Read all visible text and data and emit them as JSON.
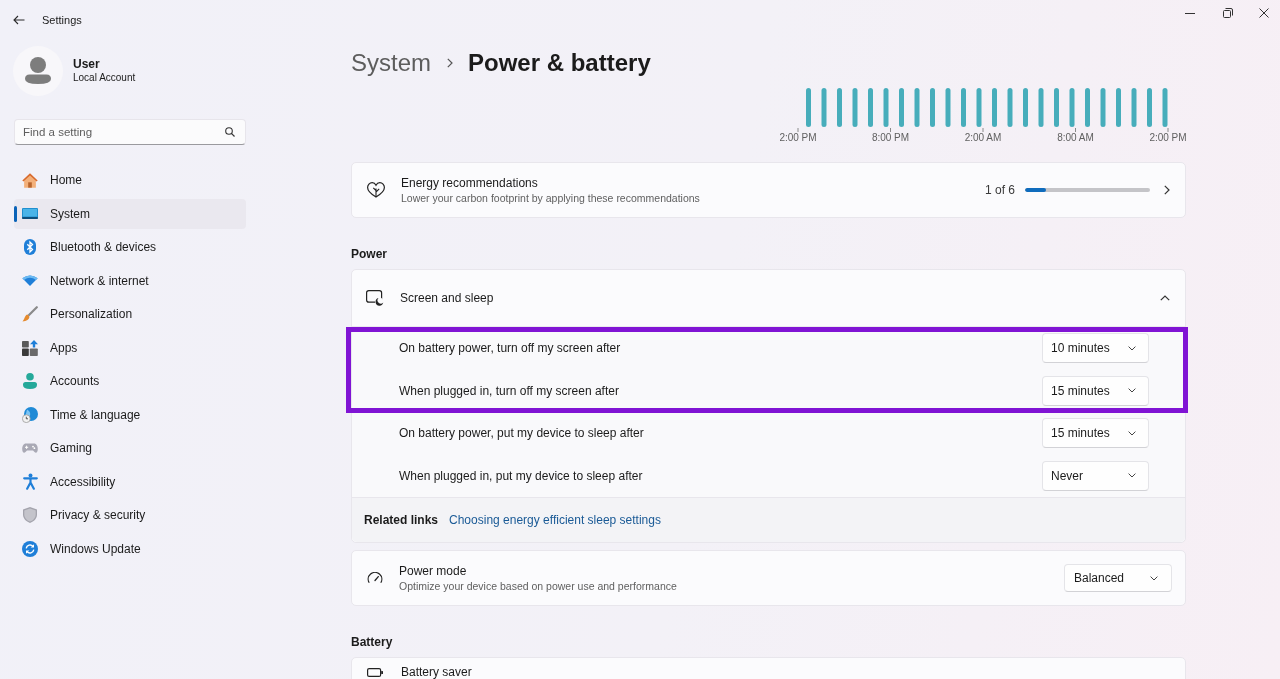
{
  "window": {
    "title": "Settings"
  },
  "account": {
    "name": "User",
    "type": "Local Account"
  },
  "search": {
    "placeholder": "Find a setting"
  },
  "sidebar": {
    "items": [
      {
        "label": "Home",
        "selected": false
      },
      {
        "label": "System",
        "selected": true
      },
      {
        "label": "Bluetooth & devices",
        "selected": false
      },
      {
        "label": "Network & internet",
        "selected": false
      },
      {
        "label": "Personalization",
        "selected": false
      },
      {
        "label": "Apps",
        "selected": false
      },
      {
        "label": "Accounts",
        "selected": false
      },
      {
        "label": "Time & language",
        "selected": false
      },
      {
        "label": "Gaming",
        "selected": false
      },
      {
        "label": "Accessibility",
        "selected": false
      },
      {
        "label": "Privacy & security",
        "selected": false
      },
      {
        "label": "Windows Update",
        "selected": false
      }
    ]
  },
  "breadcrumb": [
    {
      "label": "System",
      "current": false
    },
    {
      "label": "Power & battery",
      "current": true
    }
  ],
  "battery_chart": {
    "time_labels": [
      "2:00 PM",
      "8:00 PM",
      "2:00 AM",
      "8:00 AM",
      "2:00 PM"
    ]
  },
  "energy_recommendations": {
    "title": "Energy recommendations",
    "subtitle": "Lower your carbon footprint by applying these recommendations",
    "progress_text": "1 of 6",
    "level": 0.17
  },
  "power": {
    "heading": "Power",
    "screen_and_sleep": {
      "title": "Screen and sleep",
      "expanded": true,
      "settings": [
        {
          "label": "On battery power, turn off my screen after",
          "value": "10 minutes",
          "highlighted": true
        },
        {
          "label": "When plugged in, turn off my screen after",
          "value": "15 minutes",
          "highlighted": true
        },
        {
          "label": "On battery power, put my device to sleep after",
          "value": "15 minutes",
          "highlighted": false
        },
        {
          "label": "When plugged in, put my device to sleep after",
          "value": "Never",
          "highlighted": false
        }
      ],
      "related_links": {
        "label": "Related links",
        "link": "Choosing energy efficient sleep settings"
      }
    },
    "power_mode": {
      "title": "Power mode",
      "subtitle": "Optimize your device based on power use and performance",
      "value": "Balanced"
    }
  },
  "battery": {
    "heading": "Battery",
    "battery_saver": {
      "title": "Battery saver"
    }
  }
}
